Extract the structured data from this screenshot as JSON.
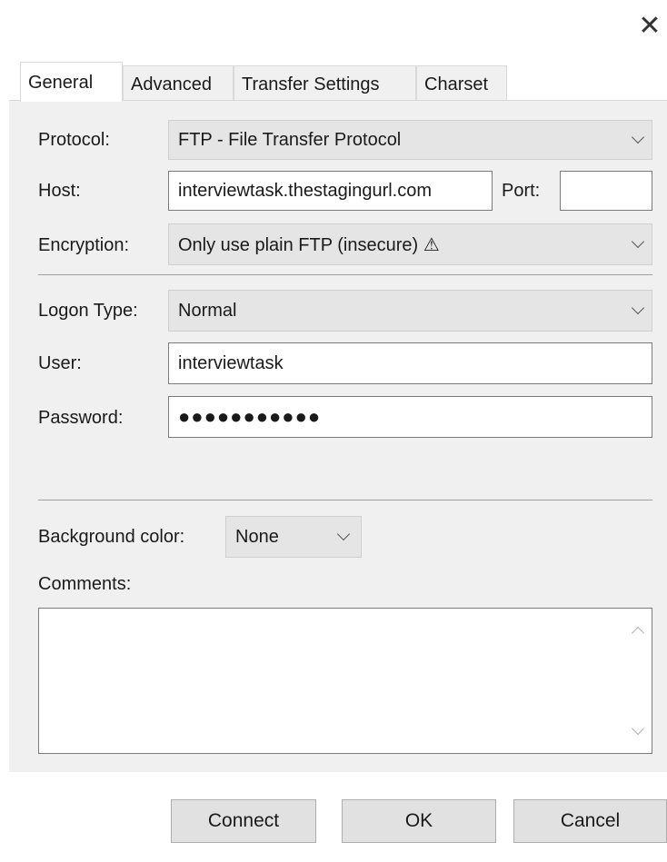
{
  "dialog": {
    "close_glyph": "✕"
  },
  "tabs": [
    {
      "label": "General"
    },
    {
      "label": "Advanced"
    },
    {
      "label": "Transfer Settings"
    },
    {
      "label": "Charset"
    }
  ],
  "general": {
    "protocol_label": "Protocol:",
    "protocol_value": "FTP - File Transfer Protocol",
    "host_label": "Host:",
    "host_value": "interviewtask.thestagingurl.com",
    "port_label": "Port:",
    "port_value": "",
    "encryption_label": "Encryption:",
    "encryption_value": "Only use plain FTP (insecure) ⚠",
    "logon_type_label": "Logon Type:",
    "logon_type_value": "Normal",
    "user_label": "User:",
    "user_value": "interviewtask",
    "password_label": "Password:",
    "password_value": "●●●●●●●●●●●",
    "bg_color_label": "Background color:",
    "bg_color_value": "None",
    "comments_label": "Comments:",
    "comments_value": ""
  },
  "buttons": {
    "connect": "Connect",
    "ok": "OK",
    "cancel": "Cancel"
  },
  "colors": {
    "pane_bg": "#f0f0f0",
    "combo_bg": "#e5e5e5",
    "button_bg": "#e1e1e1"
  }
}
